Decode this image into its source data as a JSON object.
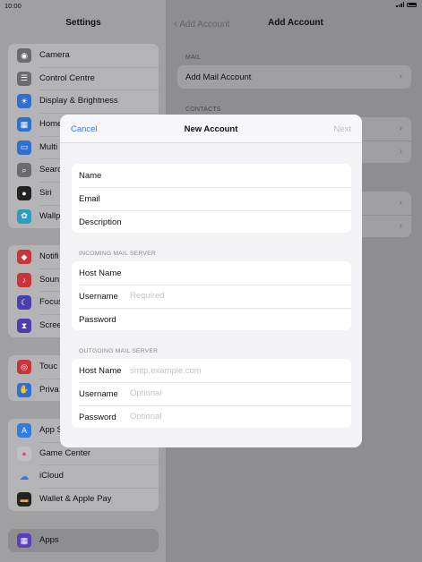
{
  "status_bar": {
    "time": "10:00"
  },
  "sidebar": {
    "title": "Settings",
    "groups": [
      {
        "items": [
          {
            "label": "Camera",
            "icon": "camera-icon",
            "color": "#6b6b70"
          },
          {
            "label": "Control Centre",
            "icon": "control-centre-icon",
            "color": "#6b6b70"
          },
          {
            "label": "Display & Brightness",
            "icon": "display-brightness-icon",
            "color": "#2f6fd0"
          },
          {
            "label": "Home",
            "icon": "home-screen-icon",
            "color": "#2f6fd0"
          },
          {
            "label": "Multi",
            "icon": "multitasking-icon",
            "color": "#2f6fd0"
          },
          {
            "label": "Searc",
            "icon": "search-icon",
            "color": "#6b6b70"
          },
          {
            "label": "Siri",
            "icon": "siri-icon",
            "color": "#222"
          },
          {
            "label": "Wallp",
            "icon": "wallpaper-icon",
            "color": "#2f9bc0"
          }
        ]
      },
      {
        "items": [
          {
            "label": "Notifi",
            "icon": "notifications-icon",
            "color": "#c8343a"
          },
          {
            "label": "Soun",
            "icon": "sounds-icon",
            "color": "#c8343a"
          },
          {
            "label": "Focus",
            "icon": "focus-icon",
            "color": "#4b3fb0"
          },
          {
            "label": "Scree",
            "icon": "screen-time-icon",
            "color": "#4b3fb0"
          }
        ]
      },
      {
        "items": [
          {
            "label": "Touc",
            "icon": "touch-id-icon",
            "color": "#c8343a"
          },
          {
            "label": "Priva",
            "icon": "privacy-icon",
            "color": "#2f6fd0"
          }
        ]
      },
      {
        "items": [
          {
            "label": "App S",
            "icon": "app-store-icon",
            "color": "#2f7de0"
          },
          {
            "label": "Game Center",
            "icon": "game-center-icon",
            "color": "#c0c0c4"
          },
          {
            "label": "iCloud",
            "icon": "icloud-icon",
            "color": "#b4b4b6"
          },
          {
            "label": "Wallet & Apple Pay",
            "icon": "wallet-icon",
            "color": "#222"
          }
        ]
      },
      {
        "items": [
          {
            "label": "Apps",
            "icon": "apps-icon",
            "color": "#5b3fb8"
          }
        ]
      }
    ]
  },
  "detail": {
    "back_label": "Add Account",
    "title": "Add Account",
    "mail_section": "MAIL",
    "add_mail_label": "Add Mail Account",
    "contacts_section": "CONTACTS"
  },
  "modal": {
    "cancel": "Cancel",
    "title": "New Account",
    "next": "Next",
    "account_rows": [
      {
        "label": "Name",
        "placeholder": ""
      },
      {
        "label": "Email",
        "placeholder": ""
      },
      {
        "label": "Description",
        "placeholder": ""
      }
    ],
    "incoming_section": "INCOMING MAIL SERVER",
    "incoming_rows": [
      {
        "label": "Host Name",
        "placeholder": ""
      },
      {
        "label": "Username",
        "placeholder": "Required"
      },
      {
        "label": "Password",
        "placeholder": ""
      }
    ],
    "outgoing_section": "OUTGOING MAIL SERVER",
    "outgoing_rows": [
      {
        "label": "Host Name",
        "placeholder": "smtp.example.com"
      },
      {
        "label": "Username",
        "placeholder": "Optional"
      },
      {
        "label": "Password",
        "placeholder": "Optional"
      }
    ]
  }
}
